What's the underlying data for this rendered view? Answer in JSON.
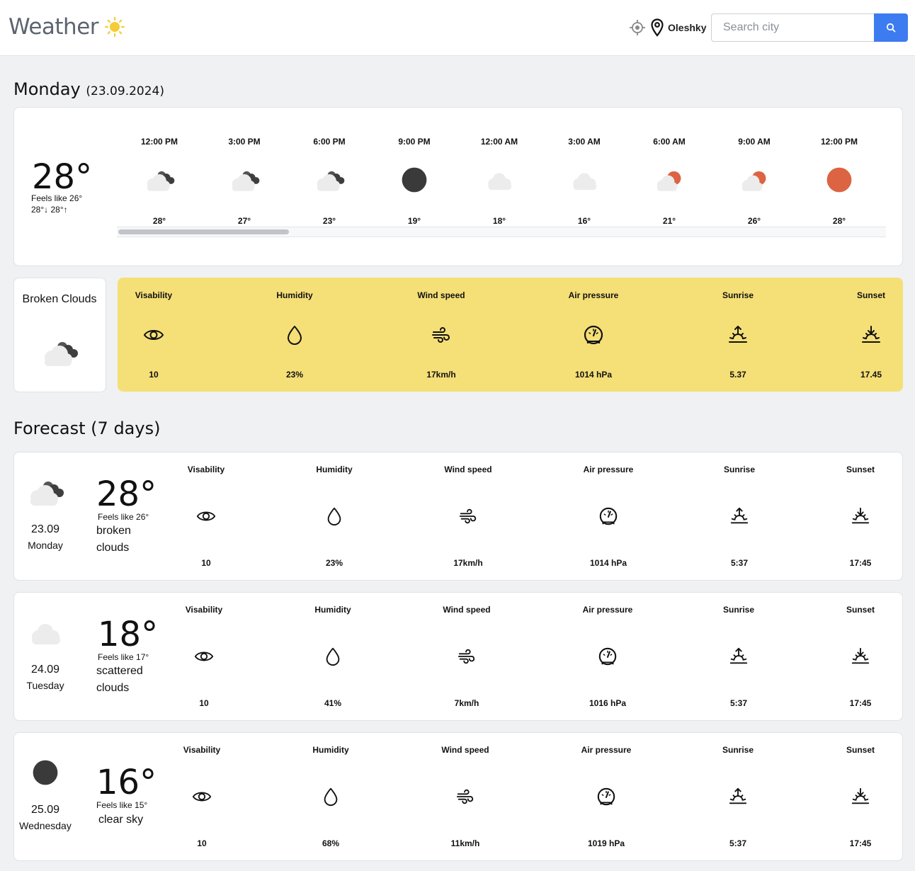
{
  "header": {
    "app_title": "Weather",
    "city": "Oleshky",
    "search_placeholder": "Search city"
  },
  "today": {
    "day_name": "Monday",
    "date": "(23.09.2024)",
    "temperature": "28°",
    "feels_like": "Feels like 26°",
    "min_max": "28°↓  28°↑",
    "hourly": [
      {
        "time": "12:00 PM",
        "temp": "28°",
        "icon": "broken-clouds-icon"
      },
      {
        "time": "3:00 PM",
        "temp": "27°",
        "icon": "broken-clouds-icon"
      },
      {
        "time": "6:00 PM",
        "temp": "23°",
        "icon": "broken-clouds-icon"
      },
      {
        "time": "9:00 PM",
        "temp": "19°",
        "icon": "clear-night-icon"
      },
      {
        "time": "12:00 AM",
        "temp": "18°",
        "icon": "cloud-icon"
      },
      {
        "time": "3:00 AM",
        "temp": "16°",
        "icon": "cloud-icon"
      },
      {
        "time": "6:00 AM",
        "temp": "21°",
        "icon": "partly-cloudy-day-icon"
      },
      {
        "time": "9:00 AM",
        "temp": "26°",
        "icon": "partly-cloudy-day-icon"
      },
      {
        "time": "12:00 PM",
        "temp": "28°",
        "icon": "sun-icon"
      }
    ],
    "description": "Broken Clouds",
    "stats": [
      {
        "label": "Visability",
        "value": "10",
        "icon": "eye-icon"
      },
      {
        "label": "Humidity",
        "value": "23%",
        "icon": "droplet-icon"
      },
      {
        "label": "Wind speed",
        "value": "17km/h",
        "icon": "wind-icon"
      },
      {
        "label": "Air pressure",
        "value": "1014 hPa",
        "icon": "gauge-icon"
      },
      {
        "label": "Sunrise",
        "value": "5.37",
        "icon": "sunrise-icon"
      },
      {
        "label": "Sunset",
        "value": "17.45",
        "icon": "sunset-icon"
      }
    ]
  },
  "forecast": {
    "heading": "Forecast (7 days)",
    "stat_labels": [
      "Visability",
      "Humidity",
      "Wind speed",
      "Air pressure",
      "Sunrise",
      "Sunset"
    ],
    "days": [
      {
        "date": "23.09",
        "day": "Monday",
        "temp": "28°",
        "feels_like": "Feels like 26°",
        "desc_line1": "broken",
        "desc_line2": "clouds",
        "icon": "broken-clouds-icon",
        "values": [
          "10",
          "23%",
          "17km/h",
          "1014 hPa",
          "5:37",
          "17:45"
        ]
      },
      {
        "date": "24.09",
        "day": "Tuesday",
        "temp": "18°",
        "feels_like": "Feels like 17°",
        "desc_line1": "scattered",
        "desc_line2": "clouds",
        "icon": "cloud-icon",
        "values": [
          "10",
          "41%",
          "7km/h",
          "1016 hPa",
          "5:37",
          "17:45"
        ]
      },
      {
        "date": "25.09",
        "day": "Wednesday",
        "temp": "16°",
        "feels_like": "Feels like 15°",
        "desc_line1": "clear sky",
        "desc_line2": "",
        "icon": "clear-night-icon",
        "values": [
          "10",
          "68%",
          "11km/h",
          "1019 hPa",
          "5:37",
          "17:45"
        ]
      }
    ]
  },
  "colors": {
    "accent": "#3d7bf0",
    "stats_panel": "#f5df77",
    "sun": "#dc6443",
    "moon": "#3a3a3a",
    "logo_sun": "#f5cc36"
  }
}
